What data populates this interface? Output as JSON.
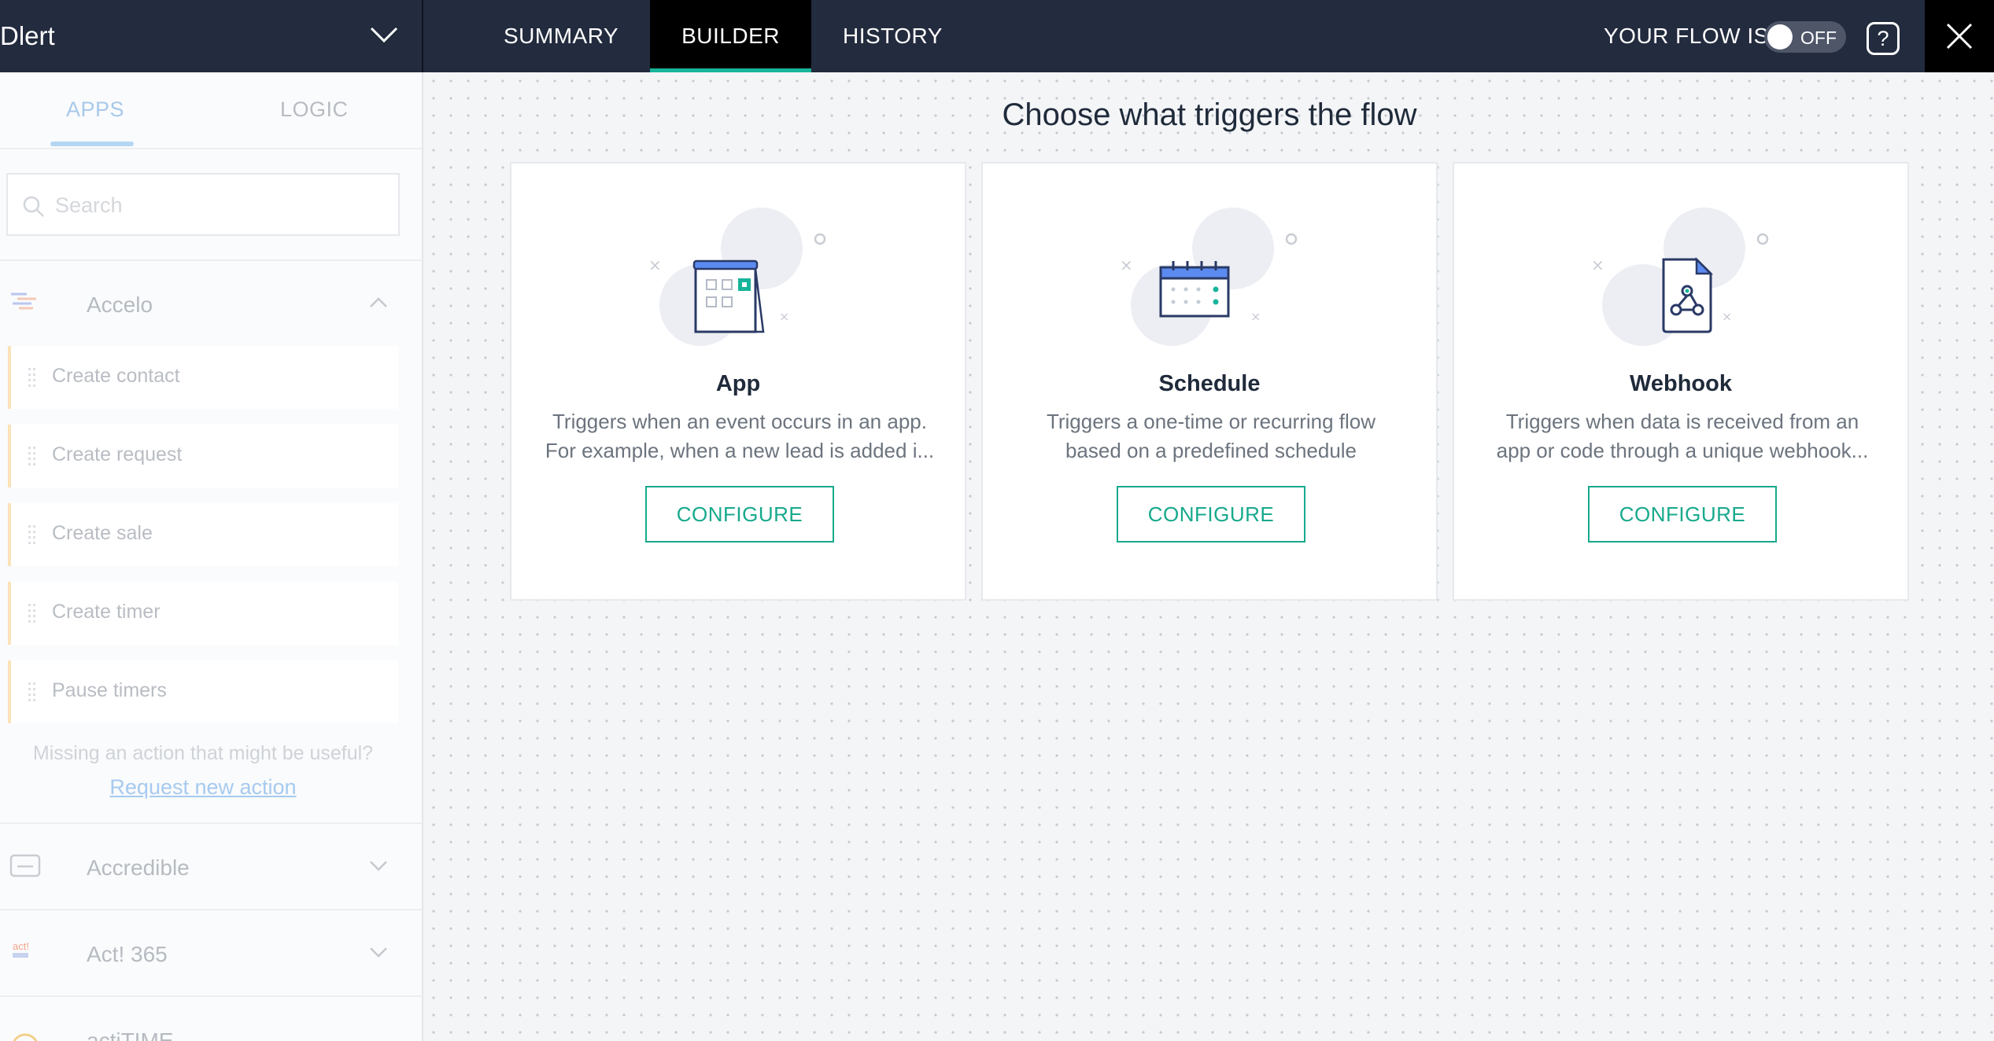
{
  "header": {
    "flow_name": "Dlert",
    "tabs": [
      {
        "label": "SUMMARY"
      },
      {
        "label": "BUILDER"
      },
      {
        "label": "HISTORY"
      }
    ],
    "flow_status_label": "YOUR FLOW IS",
    "toggle_label": "OFF",
    "help_label": "?"
  },
  "sidebar": {
    "tabs": {
      "apps": "APPS",
      "logic": "LOGIC"
    },
    "search_placeholder": "Search",
    "apps": [
      {
        "name": "Accelo",
        "expanded": true
      },
      {
        "name": "Accredible",
        "expanded": false
      },
      {
        "name": "Act! 365",
        "expanded": false
      },
      {
        "name": "actiTIME",
        "expanded": false
      }
    ],
    "actions": [
      {
        "label": "Create contact"
      },
      {
        "label": "Create request"
      },
      {
        "label": "Create sale"
      },
      {
        "label": "Create timer"
      },
      {
        "label": "Pause timers"
      }
    ],
    "missing_text": "Missing an action that might be useful?",
    "request_link": "Request new action",
    "act_logo_text": "act!"
  },
  "canvas": {
    "title": "Choose what triggers the flow",
    "cards": [
      {
        "title": "App",
        "desc_line1": "Triggers when an event occurs in an app.",
        "desc_line2": "For example, when a new lead is added i...",
        "button": "CONFIGURE"
      },
      {
        "title": "Schedule",
        "desc_line1": "Triggers a one-time or recurring flow",
        "desc_line2": "based on a predefined schedule",
        "button": "CONFIGURE"
      },
      {
        "title": "Webhook",
        "desc_line1": "Triggers when data is received from an",
        "desc_line2": "app or code through a unique webhook...",
        "button": "CONFIGURE"
      }
    ]
  },
  "colors": {
    "topbar": "#232b3e",
    "accent": "#17a98c",
    "icon_blue": "#2f5fbf"
  }
}
